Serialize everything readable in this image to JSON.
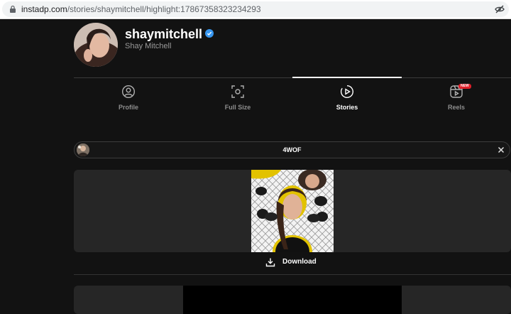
{
  "browser": {
    "url_host": "instadp.com",
    "url_path": "/stories/shaymitchell/highlight:17867358323234293"
  },
  "profile": {
    "username": "shaymitchell",
    "full_name": "Shay Mitchell",
    "verified": true
  },
  "tabs": [
    {
      "label": "Profile",
      "icon": "user-circle-icon",
      "active": false
    },
    {
      "label": "Full Size",
      "icon": "focus-frame-icon",
      "active": false
    },
    {
      "label": "Stories",
      "icon": "play-circle-icon",
      "active": true
    },
    {
      "label": "Reels",
      "icon": "reels-icon",
      "active": false,
      "badge": "NEW"
    }
  ],
  "highlight": {
    "title": "4WOF"
  },
  "story": {
    "download_label": "Download"
  },
  "colors": {
    "background": "#121212",
    "card": "#262626",
    "verified_blue": "#3897f0",
    "badge_red": "#e0202a"
  }
}
